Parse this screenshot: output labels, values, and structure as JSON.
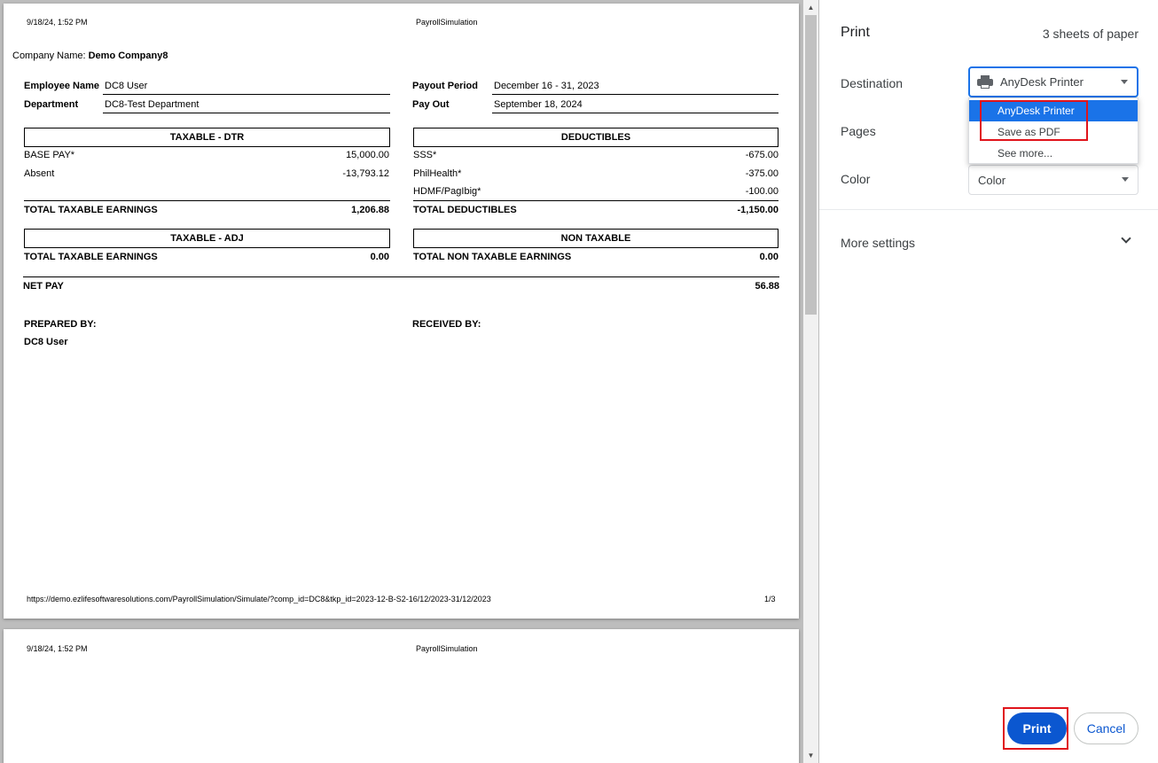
{
  "page_header": {
    "datetime": "9/18/24, 1:52 PM",
    "title": "PayrollSimulation"
  },
  "company": {
    "label": "Company Name:",
    "name": "Demo Company8"
  },
  "employee": {
    "name_label": "Employee Name",
    "name": "DC8 User",
    "dept_label": "Department",
    "dept": "DC8-Test Department",
    "period_label": "Payout Period",
    "period": "December 16 - 31, 2023",
    "payout_label": "Pay Out",
    "payout": "September 18, 2024"
  },
  "taxable_dtr": {
    "header": "TAXABLE - DTR",
    "rows": [
      {
        "label": "BASE PAY*",
        "value": "15,000.00"
      },
      {
        "label": "Absent",
        "value": "-13,793.12"
      }
    ],
    "total_label": "TOTAL TAXABLE EARNINGS",
    "total": "1,206.88"
  },
  "deductibles": {
    "header": "DEDUCTIBLES",
    "rows": [
      {
        "label": "SSS*",
        "value": "-675.00"
      },
      {
        "label": "PhilHealth*",
        "value": "-375.00"
      },
      {
        "label": "HDMF/PagIbig*",
        "value": "-100.00"
      }
    ],
    "total_label": "TOTAL DEDUCTIBLES",
    "total": "-1,150.00"
  },
  "taxable_adj": {
    "header": "TAXABLE - ADJ",
    "total_label": "TOTAL TAXABLE EARNINGS",
    "total": "0.00"
  },
  "non_taxable": {
    "header": "NON TAXABLE",
    "total_label": "TOTAL NON TAXABLE EARNINGS",
    "total": "0.00"
  },
  "net_pay": {
    "label": "NET PAY",
    "value": "56.88"
  },
  "signatures": {
    "prepared_label": "PREPARED BY:",
    "prepared_name": "DC8 User",
    "received_label": "RECEIVED BY:"
  },
  "page_footer": {
    "url": "https://demo.ezlifesoftwaresolutions.com/PayrollSimulation/Simulate/?comp_id=DC8&tkp_id=2023-12-B-S2-16/12/2023-31/12/2023",
    "page_num": "1/3"
  },
  "print_panel": {
    "title": "Print",
    "sheets": "3 sheets of paper",
    "destination_label": "Destination",
    "destination_value": "AnyDesk Printer",
    "destination_options": [
      "AnyDesk Printer",
      "Save as PDF",
      "See more..."
    ],
    "pages_label": "Pages",
    "color_label": "Color",
    "color_value": "Color",
    "more_settings": "More settings",
    "print_button": "Print",
    "cancel_button": "Cancel"
  },
  "colors": {
    "accent": "#1a73e8",
    "print_button": "#0b57d0",
    "highlight_box": "#e0141b"
  }
}
